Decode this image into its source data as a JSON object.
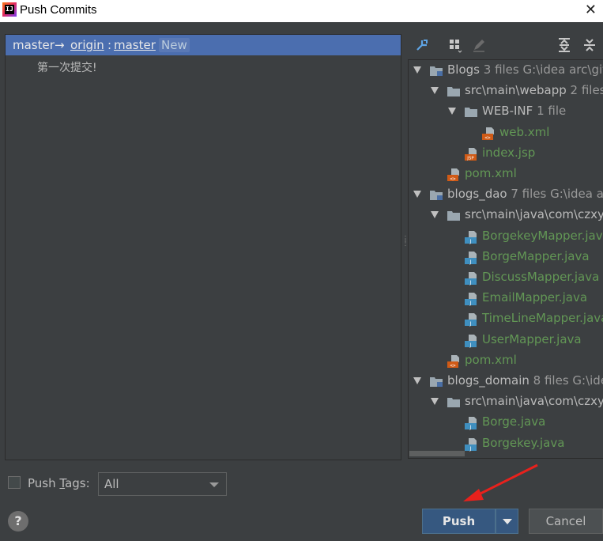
{
  "window": {
    "title": "Push Commits",
    "app_icon_text": "IJ"
  },
  "branch": {
    "local": "master",
    "arrow": "→",
    "remote": "origin",
    "sep": ":",
    "remote_branch": "master",
    "badge": "New"
  },
  "commits": [
    "第一次提交!"
  ],
  "tree": {
    "rows": [
      {
        "depth": 0,
        "expand": true,
        "icon": "module-folder",
        "name": "Blogs",
        "count": "3 files",
        "path": "G:\\idea arc\\git",
        "kind": "plain"
      },
      {
        "depth": 1,
        "expand": true,
        "icon": "folder",
        "name": "src\\main\\webapp",
        "count": "2 files",
        "path": "",
        "kind": "plain"
      },
      {
        "depth": 2,
        "expand": true,
        "icon": "folder",
        "name": "WEB-INF",
        "count": "1 file",
        "path": "",
        "kind": "plain"
      },
      {
        "depth": 3,
        "expand": null,
        "icon": "xml",
        "name": "web.xml",
        "count": "",
        "path": "",
        "kind": "green"
      },
      {
        "depth": 2,
        "expand": null,
        "icon": "jsp",
        "name": "index.jsp",
        "count": "",
        "path": "",
        "kind": "green"
      },
      {
        "depth": 1,
        "expand": null,
        "icon": "xml",
        "name": "pom.xml",
        "count": "",
        "path": "",
        "kind": "green"
      },
      {
        "depth": 0,
        "expand": true,
        "icon": "module-folder",
        "name": "blogs_dao",
        "count": "7 files",
        "path": "G:\\idea ar",
        "kind": "plain"
      },
      {
        "depth": 1,
        "expand": true,
        "icon": "folder",
        "name": "src\\main\\java\\com\\czxy\\",
        "count": "",
        "path": "",
        "kind": "plain"
      },
      {
        "depth": 2,
        "expand": null,
        "icon": "java",
        "name": "BorgekeyMapper.java",
        "count": "",
        "path": "",
        "kind": "green"
      },
      {
        "depth": 2,
        "expand": null,
        "icon": "java",
        "name": "BorgeMapper.java",
        "count": "",
        "path": "",
        "kind": "green"
      },
      {
        "depth": 2,
        "expand": null,
        "icon": "java",
        "name": "DiscussMapper.java",
        "count": "",
        "path": "",
        "kind": "green"
      },
      {
        "depth": 2,
        "expand": null,
        "icon": "java",
        "name": "EmailMapper.java",
        "count": "",
        "path": "",
        "kind": "green"
      },
      {
        "depth": 2,
        "expand": null,
        "icon": "java",
        "name": "TimeLineMapper.java",
        "count": "",
        "path": "",
        "kind": "green"
      },
      {
        "depth": 2,
        "expand": null,
        "icon": "java",
        "name": "UserMapper.java",
        "count": "",
        "path": "",
        "kind": "green"
      },
      {
        "depth": 1,
        "expand": null,
        "icon": "xml",
        "name": "pom.xml",
        "count": "",
        "path": "",
        "kind": "green"
      },
      {
        "depth": 0,
        "expand": true,
        "icon": "module-folder",
        "name": "blogs_domain",
        "count": "8 files",
        "path": "G:\\ide",
        "kind": "plain"
      },
      {
        "depth": 1,
        "expand": true,
        "icon": "folder",
        "name": "src\\main\\java\\com\\czxy\\",
        "count": "",
        "path": "",
        "kind": "plain"
      },
      {
        "depth": 2,
        "expand": null,
        "icon": "java",
        "name": "Borge.java",
        "count": "",
        "path": "",
        "kind": "green"
      },
      {
        "depth": 2,
        "expand": null,
        "icon": "java",
        "name": "Borgekey.java",
        "count": "",
        "path": "",
        "kind": "green"
      }
    ]
  },
  "footer": {
    "push_tags_label_pre": "Push ",
    "push_tags_label_mnemonic": "T",
    "push_tags_label_post": "ags:",
    "tags_select_value": "All",
    "help_label": "?",
    "push_label": "Push",
    "cancel_label": "Cancel"
  },
  "colors": {
    "selection": "#4b6eaf",
    "added_file": "#629755",
    "primary_button": "#365880",
    "annotation_arrow": "#e8211c"
  }
}
